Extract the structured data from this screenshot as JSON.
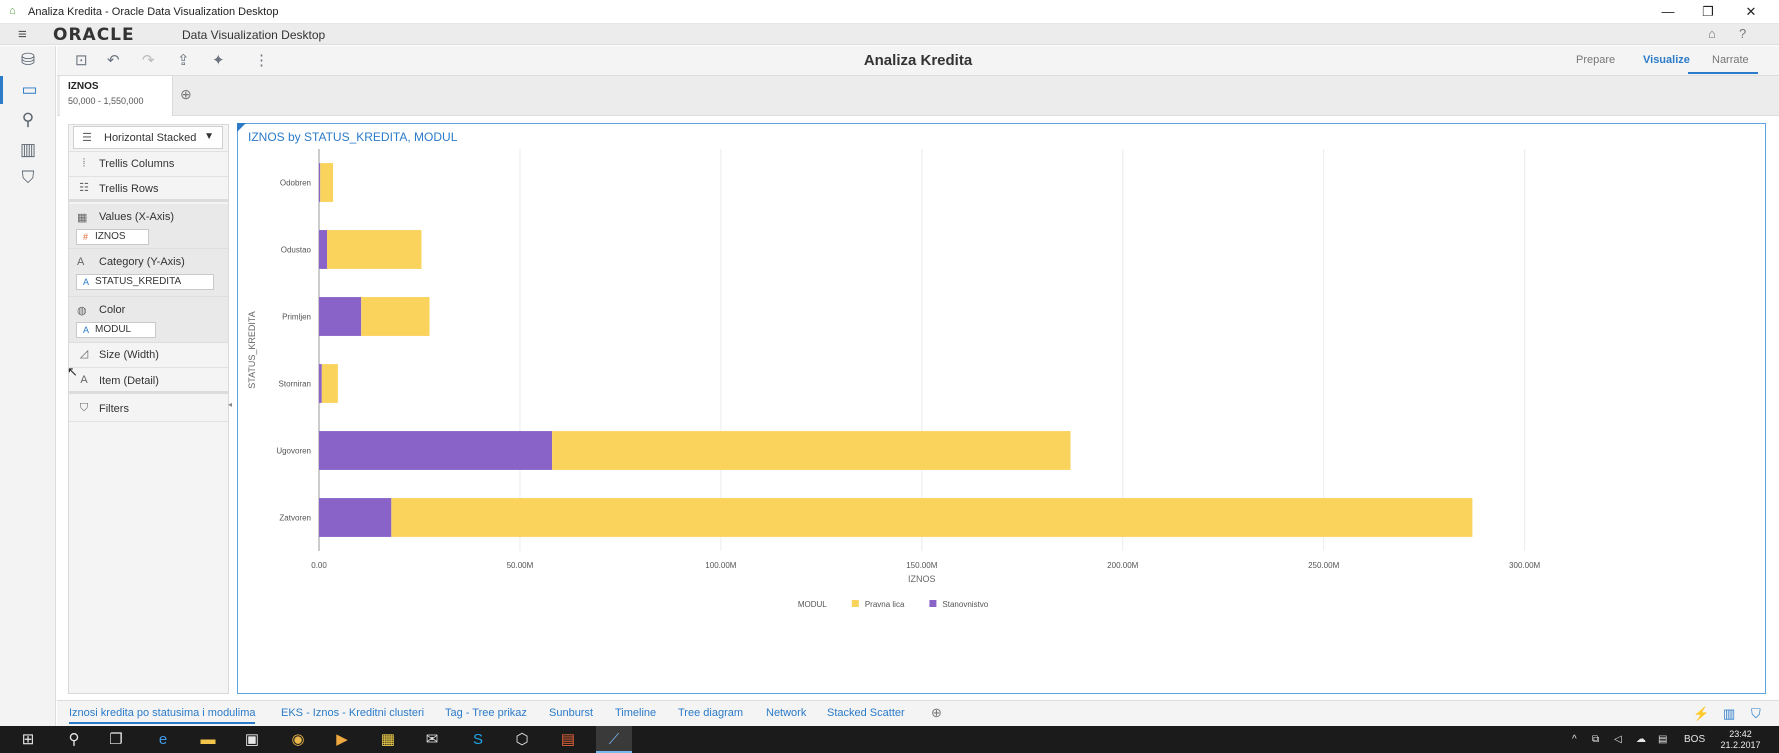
{
  "window": {
    "title": "Analiza Kredita - Oracle Data Visualization Desktop",
    "minimize": "—",
    "restore": "❐",
    "close": "✕"
  },
  "app": {
    "logo": "ORACLE",
    "name": "Data Visualization Desktop",
    "project_title": "Analiza Kredita",
    "modes": [
      "Prepare",
      "Visualize",
      "Narrate"
    ],
    "active_mode": "Visualize"
  },
  "filter": {
    "name": "IZNOS",
    "range": "50,000 - 1,550,000"
  },
  "grammar": {
    "viz_type": "Horizontal Stacked",
    "trellis_columns": "Trellis Columns",
    "trellis_rows": "Trellis Rows",
    "values_label": "Values (X-Axis)",
    "values_chip": "IZNOS",
    "category_label": "Category (Y-Axis)",
    "category_chip": "STATUS_KREDITA",
    "color_label": "Color",
    "color_chip": "MODUL",
    "size_label": "Size (Width)",
    "item_label": "Item (Detail)",
    "filters_label": "Filters"
  },
  "chart_data": {
    "type": "bar",
    "orientation": "horizontal",
    "stacked": true,
    "title": "IZNOS by STATUS_KREDITA, MODUL",
    "xlabel": "IZNOS",
    "ylabel": "STATUS_KREDITA",
    "xlim": [
      0,
      320
    ],
    "x_ticks": [
      0,
      50,
      100,
      150,
      200,
      250,
      300
    ],
    "x_tick_labels": [
      "0.00",
      "50.00M",
      "100.00M",
      "150.00M",
      "200.00M",
      "250.00M",
      "300.00M"
    ],
    "categories": [
      "Odobren",
      "Odustao",
      "Primljen",
      "Storniran",
      "Ugovoren",
      "Zatvoren"
    ],
    "series": [
      {
        "name": "Stanovnistvo",
        "color": "#8a63c9",
        "values": [
          0.3,
          2,
          10.5,
          0.7,
          58,
          18
        ]
      },
      {
        "name": "Pravna lica",
        "color": "#f9d35c",
        "values": [
          3.2,
          23.5,
          17,
          4,
          129,
          269
        ]
      }
    ],
    "legend_title": "MODUL",
    "legend_order": [
      "Pravna lica",
      "Stanovnistvo"
    ],
    "legend_position": "bottom-center",
    "grid": "vertical"
  },
  "canvas_tabs": [
    "Iznosi kredita po statusima i modulima",
    "EKS - Iznos - Kreditni clusteri",
    "Tag - Tree prikaz",
    "Sunburst",
    "Timeline",
    "Tree diagram",
    "Network",
    "Stacked Scatter"
  ],
  "taskbar": {
    "language": "BOS",
    "time": "23:42",
    "date": "21.2.2017"
  },
  "colors": {
    "accent": "#2b7bc9",
    "stanovnistvo": "#8a63c9",
    "pravna_lica": "#f9d35c"
  }
}
